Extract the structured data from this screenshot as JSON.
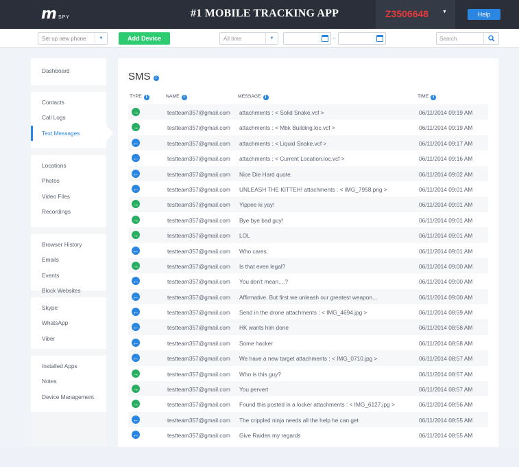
{
  "header": {
    "logo_m": "m",
    "logo_spy": "SPY",
    "title": "#1 MOBILE TRACKING APP",
    "device_id": "Z3506648",
    "help_label": "Help"
  },
  "toolbar": {
    "phone_select_value": "Set up new phone",
    "add_device_label": "Add Device",
    "time_select_value": "All time",
    "date_separator": "–",
    "search_placeholder": "Search"
  },
  "sidebar": {
    "groups": [
      [
        "Dashboard"
      ],
      [
        "Contacts",
        "Call Logs",
        "Text Messages"
      ],
      [
        "Locations",
        "Photos",
        "Video Files",
        "Recordings"
      ],
      [
        "Browser History",
        "Emails",
        "Events",
        "Block Websites"
      ],
      [
        "Skype",
        "WhatsApp",
        "Viber"
      ],
      [
        "Installed Apps",
        "Notes",
        "Device Management"
      ]
    ],
    "active": "Text Messages"
  },
  "main": {
    "title": "SMS",
    "columns": {
      "type": "TYPE",
      "name": "NAME",
      "message": "MESSAGE",
      "time": "TIME"
    },
    "rows": [
      {
        "dir": "out",
        "name": "testteam357@gmail.com",
        "message": " attachments : < Solid Snake.vcf >",
        "time": "06/11/2014 09:19 AM"
      },
      {
        "dir": "out",
        "name": "testteam357@gmail.com",
        "message": " attachments : < Mbk Building.loc.vcf >",
        "time": "06/11/2014 09:19 AM"
      },
      {
        "dir": "in",
        "name": "testteam357@gmail.com",
        "message": " attachments : < Liquid Snake.vcf >",
        "time": "06/11/2014 09:17 AM"
      },
      {
        "dir": "in",
        "name": "testteam357@gmail.com",
        "message": " attachments : < Current Location.loc.vcf >",
        "time": "06/11/2014 09:16 AM"
      },
      {
        "dir": "in",
        "name": "testteam357@gmail.com",
        "message": "Nice Die Hard quote.",
        "time": "06/11/2014 09:02 AM"
      },
      {
        "dir": "in",
        "name": "testteam357@gmail.com",
        "message": "UNLEASH THE KITTEH! attachments : < IMG_7958.png >",
        "time": "06/11/2014 09:01 AM"
      },
      {
        "dir": "out",
        "name": "testteam357@gmail.com",
        "message": "Yippee ki yay!",
        "time": "06/11/2014 09:01 AM"
      },
      {
        "dir": "out",
        "name": "testteam357@gmail.com",
        "message": "Bye bye bad guy!",
        "time": "06/11/2014 09:01 AM"
      },
      {
        "dir": "out",
        "name": "testteam357@gmail.com",
        "message": "LOL",
        "time": "06/11/2014 09:01 AM"
      },
      {
        "dir": "in",
        "name": "testteam357@gmail.com",
        "message": "Who cares.",
        "time": "06/11/2014 09:01 AM"
      },
      {
        "dir": "out",
        "name": "testteam357@gmail.com",
        "message": "Is that even legal?",
        "time": "06/11/2014 09:00 AM"
      },
      {
        "dir": "in",
        "name": "testteam357@gmail.com",
        "message": "You don't mean....?",
        "time": "06/11/2014 09:00 AM"
      },
      {
        "dir": "in",
        "name": "testteam357@gmail.com",
        "message": "Affirmative. But first we unleash our greatest weapon...",
        "time": "06/11/2014 09:00 AM"
      },
      {
        "dir": "in",
        "name": "testteam357@gmail.com",
        "message": "Send in the drone attachments : < IMG_4694.jpg >",
        "time": "06/11/2014 08:59 AM"
      },
      {
        "dir": "in",
        "name": "testteam357@gmail.com",
        "message": "HK wants him done",
        "time": "06/11/2014 08:58 AM"
      },
      {
        "dir": "in",
        "name": "testteam357@gmail.com",
        "message": "Some hacker",
        "time": "06/11/2014 08:58 AM"
      },
      {
        "dir": "in",
        "name": "testteam357@gmail.com",
        "message": "We have a new target attachments : < IMG_0710.jpg >",
        "time": "06/11/2014 08:57 AM"
      },
      {
        "dir": "out",
        "name": "testteam357@gmail.com",
        "message": "Who is this guy?",
        "time": "06/11/2014 08:57 AM"
      },
      {
        "dir": "out",
        "name": "testteam357@gmail.com",
        "message": "You pervert",
        "time": "06/11/2014 08:57 AM"
      },
      {
        "dir": "out",
        "name": "testteam357@gmail.com",
        "message": "Found this posted in a locker attachments : < IMG_6127.jpg >",
        "time": "06/11/2014 08:56 AM"
      },
      {
        "dir": "in",
        "name": "testteam357@gmail.com",
        "message": "The crippled ninja needs all the help he can get",
        "time": "06/11/2014 08:55 AM"
      },
      {
        "dir": "in",
        "name": "testteam357@gmail.com",
        "message": "Give Raiden my regards",
        "time": "06/11/2014 08:55 AM"
      }
    ]
  },
  "colors": {
    "header_bg": "#2b2f3a",
    "accent": "#2a86e0",
    "add_device": "#2ecc71",
    "outgoing": "#27ae60",
    "incoming": "#2a86e0",
    "device_id": "#e63b3b"
  },
  "icons": {
    "outgoing": "arrow-right-icon",
    "incoming": "arrow-left-icon",
    "info": "info-icon",
    "calendar": "calendar-icon",
    "search": "magnifier-icon"
  }
}
